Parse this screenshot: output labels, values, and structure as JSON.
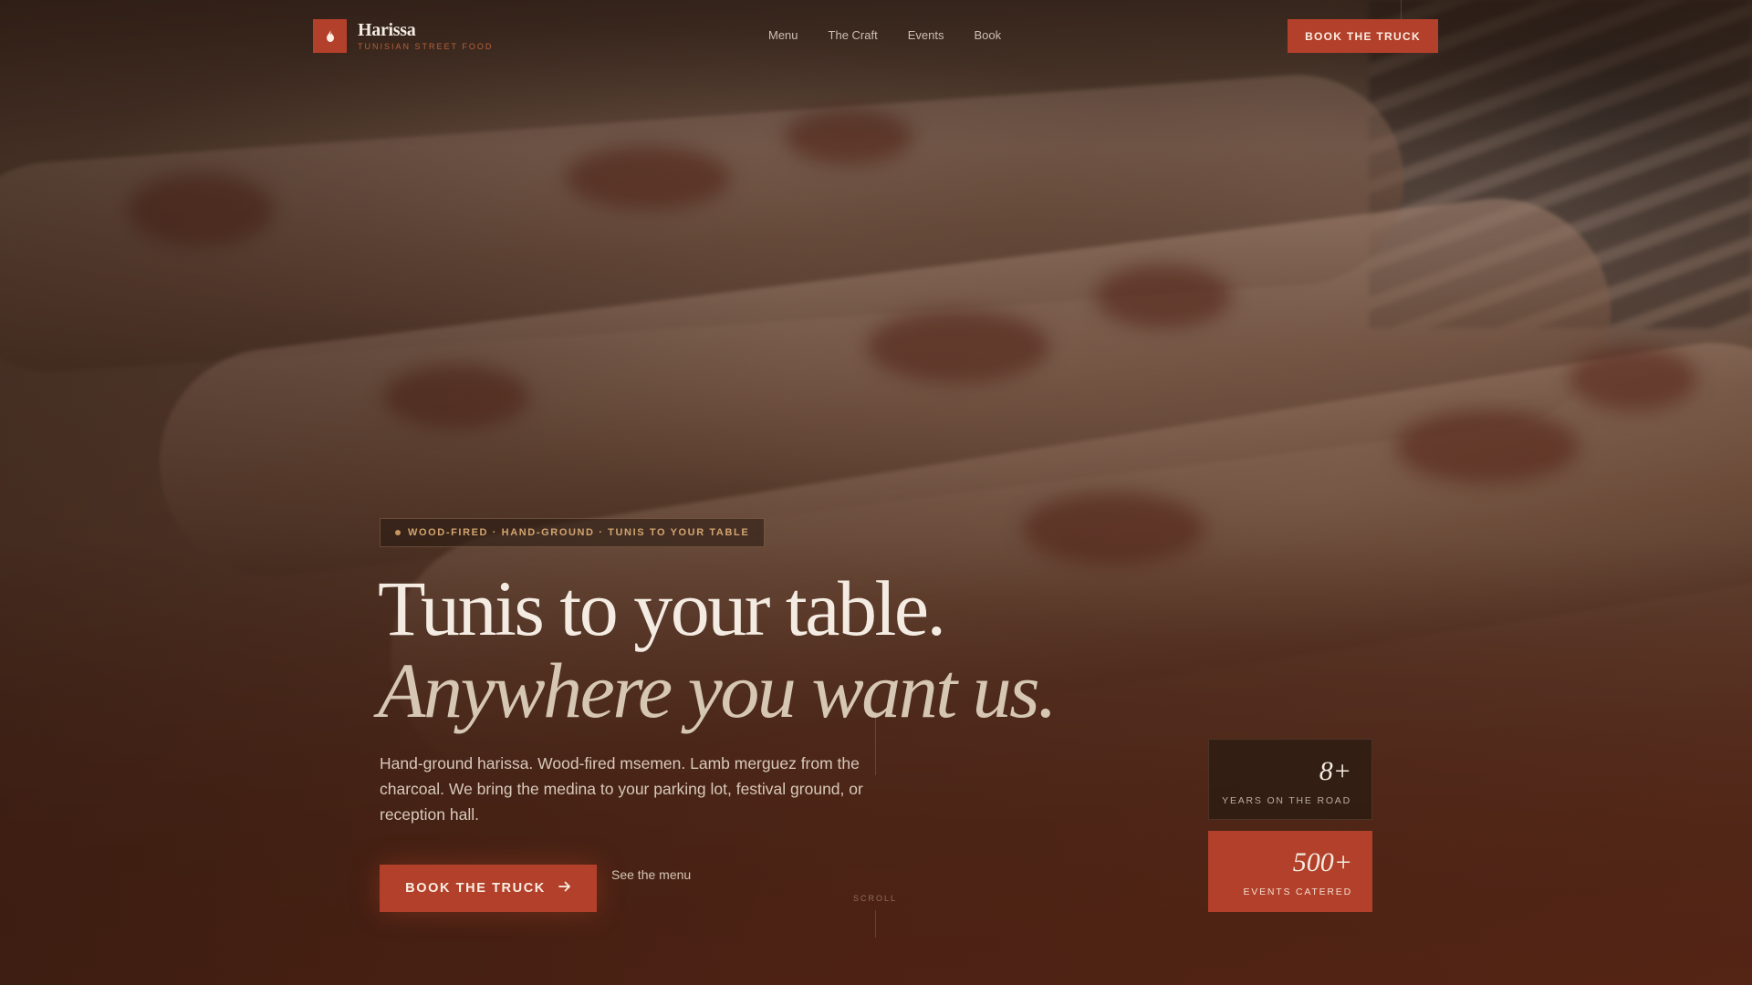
{
  "brand": {
    "name": "Harissa",
    "tagline": "TUNISIAN STREET FOOD",
    "logo_icon": "flame-icon"
  },
  "nav": {
    "links": [
      {
        "label": "Menu"
      },
      {
        "label": "The Craft"
      },
      {
        "label": "Events"
      },
      {
        "label": "Book"
      }
    ],
    "cta_label": "BOOK THE TRUCK"
  },
  "hero": {
    "eyebrow": "WOOD-FIRED · HAND-GROUND · TUNIS TO YOUR TABLE",
    "headline_line1": "Tunis to your table.",
    "headline_line2": "Anywhere you want us.",
    "lede": "Hand-ground harissa. Wood-fired msemen. Lamb merguez from the charcoal. We bring the medina to your parking lot, festival ground, or reception hall.",
    "primary_cta": "BOOK THE TRUCK",
    "primary_cta_icon": "arrow-right-icon",
    "secondary_cta": "See the menu",
    "scroll_label": "SCROLL"
  },
  "stats": [
    {
      "value": "8+",
      "label": "YEARS ON THE ROAD"
    },
    {
      "value": "500+",
      "label": "EVENTS CATERED"
    }
  ],
  "colors": {
    "accent": "#b3402a",
    "eyebrow_text": "#d2a470",
    "headline": "#f4ece2",
    "headline_italic": "#d6c6b4"
  }
}
